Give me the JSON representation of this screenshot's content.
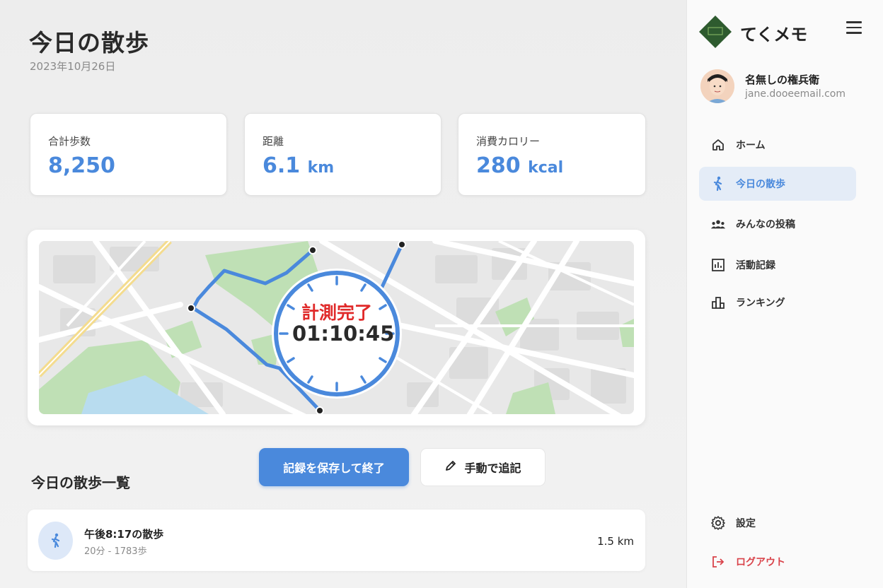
{
  "main": {
    "title": "今日の散歩",
    "date": "2023年10月26日"
  },
  "stats": [
    {
      "label": "合計歩数",
      "value": "8,250",
      "unit": ""
    },
    {
      "label": "距離",
      "value": "6.1",
      "unit": "km"
    },
    {
      "label": "消費カロリー",
      "value": "280",
      "unit": "kcal"
    }
  ],
  "map": {
    "timer_label": "計測完了",
    "timer_value": "01:10:45"
  },
  "actions": {
    "save_label": "記録を保存して終了",
    "manual_label": "手動で追記"
  },
  "list": {
    "section_title": "今日の散歩一覧",
    "items": [
      {
        "title": "午後8:17の散歩",
        "sub": "20分 - 1783歩",
        "distance": "1.5 km"
      }
    ]
  },
  "sidebar": {
    "app_name": "てくメモ",
    "user_name": "名無しの権兵衛",
    "user_email": "jane.dooeemail.com",
    "nav": [
      {
        "label": "ホーム",
        "icon": "home-icon"
      },
      {
        "label": "今日の散歩",
        "icon": "walking-icon"
      },
      {
        "label": "みんなの投稿",
        "icon": "people-icon"
      },
      {
        "label": "活動記録",
        "icon": "chart-icon"
      },
      {
        "label": "ランキング",
        "icon": "ranking-icon"
      }
    ],
    "settings_label": "設定",
    "logout_label": "ログアウト"
  },
  "colors": {
    "accent": "#4a89dc",
    "danger": "#d9434a",
    "timer_label": "#e02a2a"
  }
}
